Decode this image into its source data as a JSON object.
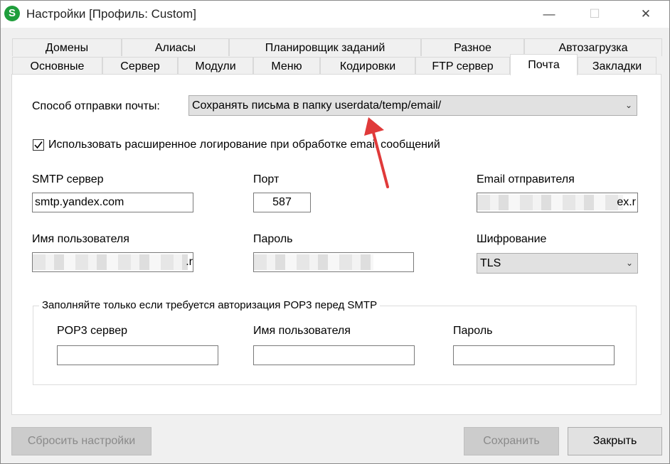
{
  "window": {
    "title": "Настройки [Профиль: Custom]",
    "app_icon_letter": "S",
    "minimize_glyph": "—",
    "maximize_glyph": "☐",
    "close_glyph": "✕"
  },
  "tabs_top": [
    "Домены",
    "Алиасы",
    "Планировщик заданий",
    "Разное",
    "Автозагрузка"
  ],
  "tabs_bottom": [
    "Основные",
    "Сервер",
    "Модули",
    "Меню",
    "Кодировки",
    "FTP сервер",
    "Почта",
    "Закладки"
  ],
  "active_tab": "Почта",
  "mail": {
    "send_method_label": "Способ отправки почты:",
    "send_method_value": "Сохранять письма в папку userdata/temp/email/",
    "logging_checkbox_label": "Использовать расширенное логирование при обработке email сообщений",
    "logging_checked": true,
    "smtp_label": "SMTP сервер",
    "smtp_value": "smtp.yandex.com",
    "port_label": "Порт",
    "port_value": "587",
    "sender_label": "Email отправителя",
    "sender_value_visible": "ex.r",
    "username_label": "Имя пользователя",
    "username_value_visible": ".r",
    "password_label": "Пароль",
    "encryption_label": "Шифрование",
    "encryption_value": "TLS"
  },
  "pop3": {
    "group_title": "Заполняйте только если требуется авторизация POP3 перед SMTP",
    "server_label": "POP3 сервер",
    "server_value": "",
    "username_label": "Имя пользователя",
    "username_value": "",
    "password_label": "Пароль",
    "password_value": ""
  },
  "footer": {
    "reset_label": "Сбросить настройки",
    "save_label": "Сохранить",
    "close_label": "Закрыть"
  },
  "colors": {
    "arrow": "#e03a3a",
    "app_icon": "#1f9e3c"
  }
}
